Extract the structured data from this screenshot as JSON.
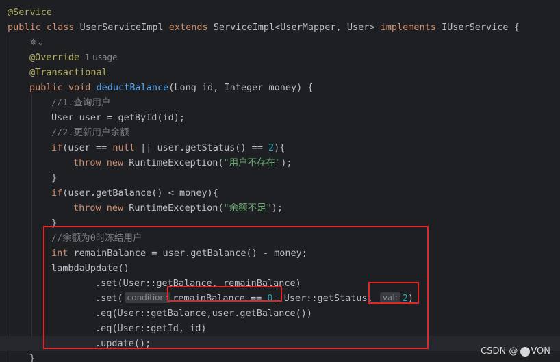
{
  "editor": {
    "lines": [
      {
        "tokens": [
          {
            "t": "@Service",
            "c": "ann"
          }
        ]
      },
      {
        "tokens": [
          {
            "t": "public class ",
            "c": "kw"
          },
          {
            "t": "UserServiceImpl "
          },
          {
            "t": "extends ",
            "c": "kw"
          },
          {
            "t": "ServiceImpl<UserMapper, User> "
          },
          {
            "t": "implements ",
            "c": "kw"
          },
          {
            "t": "IUserService {"
          }
        ]
      },
      {
        "indent": 1,
        "ai_icon": "ai-assistant-icon",
        "tokens": []
      },
      {
        "indent": 1,
        "tokens": [
          {
            "t": "@Override",
            "c": "ann"
          },
          {
            "t": "  1 usage",
            "c": "hint"
          }
        ]
      },
      {
        "indent": 1,
        "tokens": [
          {
            "t": "@Transactional",
            "c": "ann"
          }
        ]
      },
      {
        "indent": 1,
        "tokens": [
          {
            "t": "public void ",
            "c": "kw"
          },
          {
            "t": "deductBalance",
            "c": "fn"
          },
          {
            "t": "(Long id, Integer money) {"
          }
        ]
      },
      {
        "indent": 2,
        "tokens": [
          {
            "t": "//1.查询用户",
            "c": "cmt"
          }
        ]
      },
      {
        "indent": 2,
        "tokens": [
          {
            "t": "User user = getById(id);"
          }
        ]
      },
      {
        "indent": 2,
        "tokens": [
          {
            "t": "//2.更新用户余额",
            "c": "cmt"
          }
        ]
      },
      {
        "indent": 2,
        "tokens": [
          {
            "t": "if",
            "c": "kw"
          },
          {
            "t": "(user == "
          },
          {
            "t": "null",
            "c": "kw"
          },
          {
            "t": " || user.getStatus() == "
          },
          {
            "t": "2",
            "c": "num"
          },
          {
            "t": "){"
          }
        ]
      },
      {
        "indent": 3,
        "tokens": [
          {
            "t": "throw new ",
            "c": "kw"
          },
          {
            "t": "RuntimeException("
          },
          {
            "t": "\"用户不存在\"",
            "c": "str"
          },
          {
            "t": ");"
          }
        ]
      },
      {
        "indent": 2,
        "tokens": [
          {
            "t": "}"
          }
        ]
      },
      {
        "indent": 2,
        "tokens": [
          {
            "t": "if",
            "c": "kw"
          },
          {
            "t": "(user.getBalance() < money){"
          }
        ]
      },
      {
        "indent": 3,
        "tokens": [
          {
            "t": "throw new ",
            "c": "kw"
          },
          {
            "t": "RuntimeException("
          },
          {
            "t": "\"余额不足\"",
            "c": "str"
          },
          {
            "t": ");"
          }
        ]
      },
      {
        "indent": 2,
        "tokens": [
          {
            "t": "}"
          }
        ]
      },
      {
        "indent": 2,
        "tokens": [
          {
            "t": "//余额为0时冻结用户",
            "c": "cmt"
          }
        ]
      },
      {
        "indent": 2,
        "tokens": [
          {
            "t": "int ",
            "c": "kw"
          },
          {
            "t": "remainBalance = user.getBalance() - money;"
          }
        ]
      },
      {
        "indent": 2,
        "tokens": [
          {
            "t": "lambdaUpdate()"
          }
        ]
      },
      {
        "indent": 4,
        "tokens": [
          {
            "t": ".set(User::getBalance, remainBalance)"
          }
        ]
      },
      {
        "indent": 4,
        "tokens": [
          {
            "t": ".set("
          },
          {
            "t": "condition:",
            "c": "chip"
          },
          {
            "t": "remainBalance == "
          },
          {
            "t": "0",
            "c": "num"
          },
          {
            "t": ", User::getStatus, "
          },
          {
            "t": "val:",
            "c": "chip"
          },
          {
            "t": "2",
            "c": "num"
          },
          {
            "t": ")"
          }
        ]
      },
      {
        "indent": 4,
        "tokens": [
          {
            "t": ".eq(User::getBalance,user.getBalance())"
          }
        ]
      },
      {
        "indent": 4,
        "tokens": [
          {
            "t": ".eq(User::getId, id)"
          }
        ]
      },
      {
        "indent": 4,
        "current": true,
        "tokens": [
          {
            "t": ".update();"
          }
        ]
      },
      {
        "indent": 1,
        "tokens": [
          {
            "t": "}"
          }
        ]
      }
    ]
  },
  "watermark": {
    "prefix": "CSDN @",
    "suffix": "VON"
  }
}
